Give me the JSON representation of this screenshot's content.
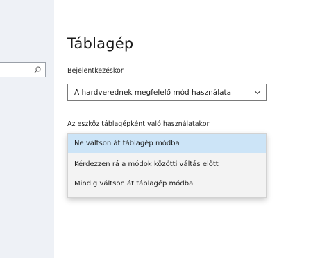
{
  "sidebar": {
    "search": {
      "value": "",
      "icon": "search-icon"
    }
  },
  "page": {
    "title": "Táblagép"
  },
  "signin": {
    "label": "Bejelentkezéskor",
    "selected_value": "A hardverednek megfelelő mód használata",
    "icon": "chevron-down-icon"
  },
  "tablet_usage": {
    "label": "Az eszköz táblagépként való használatakor",
    "options": [
      "Ne váltson át táblagép módba",
      "Kérdezzen rá a módok közötti váltás előtt",
      "Mindig váltson át táblagép módba"
    ],
    "selected_index": 0
  },
  "colors": {
    "sidebar_bg": "#eef1f6",
    "selected_option_bg": "#cce4f7",
    "dropdown_bg": "#f3f3f3"
  }
}
